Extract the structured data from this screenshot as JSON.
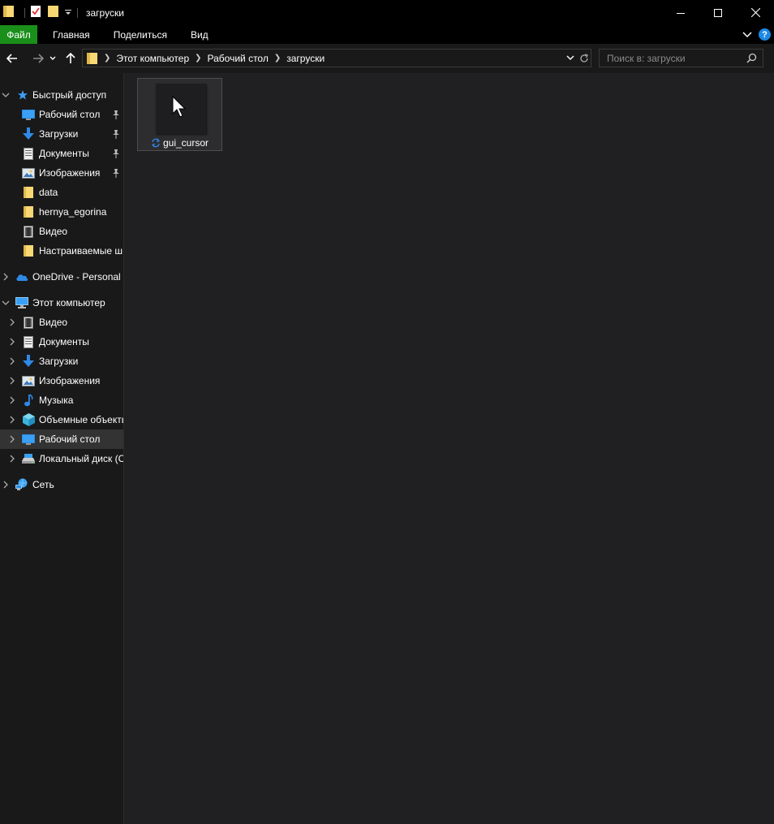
{
  "titlebar": {
    "title": "загруски"
  },
  "ribbon": {
    "tabs": [
      {
        "label": "Файл"
      },
      {
        "label": "Главная"
      },
      {
        "label": "Поделиться"
      },
      {
        "label": "Вид"
      }
    ],
    "help_label": "?"
  },
  "address": {
    "crumbs": [
      "Этот компьютер",
      "Рабочий стол",
      "загруски"
    ]
  },
  "search": {
    "placeholder": "Поиск в: загруски"
  },
  "sidebar": {
    "quick_access": {
      "label": "Быстрый доступ",
      "items": [
        {
          "label": "Рабочий стол"
        },
        {
          "label": "Загрузки"
        },
        {
          "label": "Документы"
        },
        {
          "label": "Изображения"
        },
        {
          "label": "data"
        },
        {
          "label": "hernya_egorina"
        },
        {
          "label": "Видео"
        },
        {
          "label": "Настраиваемые ш"
        }
      ]
    },
    "onedrive": {
      "label": "OneDrive - Personal"
    },
    "this_pc": {
      "label": "Этот компьютер",
      "items": [
        {
          "label": "Видео"
        },
        {
          "label": "Документы"
        },
        {
          "label": "Загрузки"
        },
        {
          "label": "Изображения"
        },
        {
          "label": "Музыка"
        },
        {
          "label": "Объемные объекты"
        },
        {
          "label": "Рабочий стол"
        },
        {
          "label": "Локальный диск (C"
        }
      ]
    },
    "network": {
      "label": "Сеть"
    }
  },
  "files": [
    {
      "name": "gui_cursor"
    }
  ],
  "colors": {
    "file_tab": "#1a8f1a",
    "sidebar_bg": "#191919",
    "main_bg": "#202023",
    "accent_blue": "#1e88e5",
    "folder_yellow": "#f8d775"
  }
}
